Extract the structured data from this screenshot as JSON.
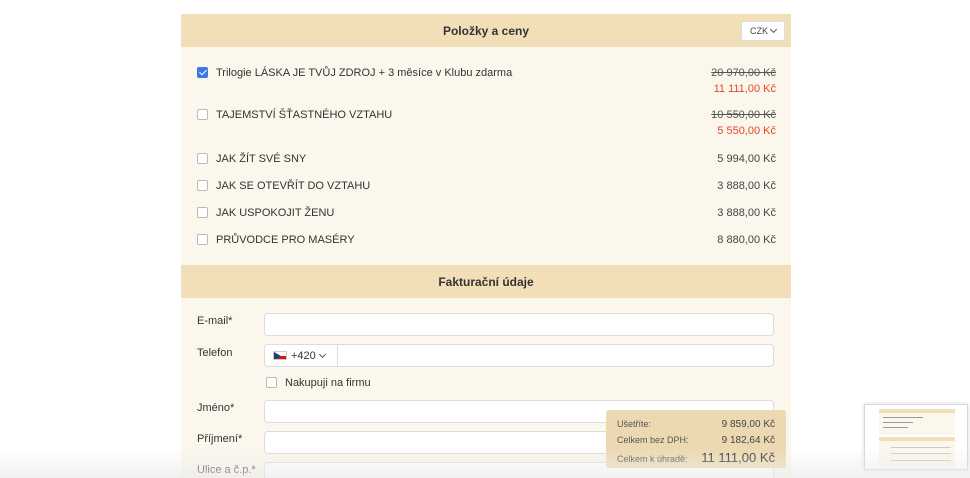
{
  "items_section": {
    "title": "Položky a ceny",
    "currency": "CZK",
    "items": [
      {
        "name": "Trilogie LÁSKA JE TVŮJ ZDROJ + 3 měsíce v Klubu zdarma",
        "checked": true,
        "old_price": "20 970,00 Kč",
        "price": "11 111,00 Kč"
      },
      {
        "name": "TAJEMSTVÍ ŠŤASTNÉHO VZTAHU",
        "checked": false,
        "old_price": "10 550,00 Kč",
        "price": "5 550,00 Kč"
      },
      {
        "name": "JAK ŽÍT SVÉ SNY",
        "checked": false,
        "price": "5 994,00 Kč"
      },
      {
        "name": "JAK SE OTEVŘÍT DO VZTAHU",
        "checked": false,
        "price": "3 888,00 Kč"
      },
      {
        "name": "JAK USPOKOJIT ŽENU",
        "checked": false,
        "price": "3 888,00 Kč"
      },
      {
        "name": "PRŮVODCE PRO MASÉRY",
        "checked": false,
        "price": "8 880,00 Kč"
      }
    ]
  },
  "billing_section": {
    "title": "Fakturační údaje",
    "email_label": "E-mail*",
    "phone_label": "Telefon",
    "phone_prefix": "+420",
    "company_label": "Nakupuji na firmu",
    "first_name_label": "Jméno*",
    "last_name_label": "Příjmení*",
    "street_label": "Ulice a č.p.*"
  },
  "summary": {
    "saved_label": "Ušetříte:",
    "saved_value": "9 859,00 Kč",
    "net_label": "Celkem bez DPH:",
    "net_value": "9 182,64 Kč",
    "total_label": "Celkem k úhradě:",
    "total_value": "11 111,00 Kč"
  },
  "colors": {
    "section_header": "#f2dfb7",
    "panel_bg": "#fcf7ec",
    "discount_price": "#e8452c",
    "checkbox_checked": "#3b7be0",
    "summary_bg": "#ecd9b2"
  }
}
